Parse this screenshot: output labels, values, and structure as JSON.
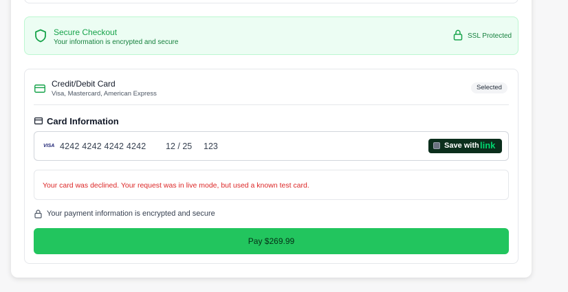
{
  "secure_banner": {
    "title": "Secure Checkout",
    "subtitle": "Your information is encrypted and secure",
    "ssl_label": "SSL Protected",
    "accent_color": "#16a34a"
  },
  "payment_method": {
    "title": "Credit/Debit Card",
    "subtitle": "Visa, Mastercard, American Express",
    "badge": "Selected"
  },
  "card_information": {
    "title": "Card Information",
    "brand_icon_text": "VISA",
    "number": "4242 4242 4242 4242",
    "expiry": "12 / 25",
    "cvc": "123",
    "link_save_label": "Save with",
    "link_brand": "link"
  },
  "error": {
    "message": "Your card was declined. Your request was in live mode, but used a known test card.",
    "color": "#dc2626"
  },
  "encryption_note": "Your payment information is encrypted and secure",
  "pay_button": {
    "label": "Pay $269.99",
    "color": "#22c55e"
  },
  "icons": [
    "shield-icon",
    "lock-icon",
    "credit-card-icon",
    "card-info-icon",
    "visa-icon"
  ]
}
